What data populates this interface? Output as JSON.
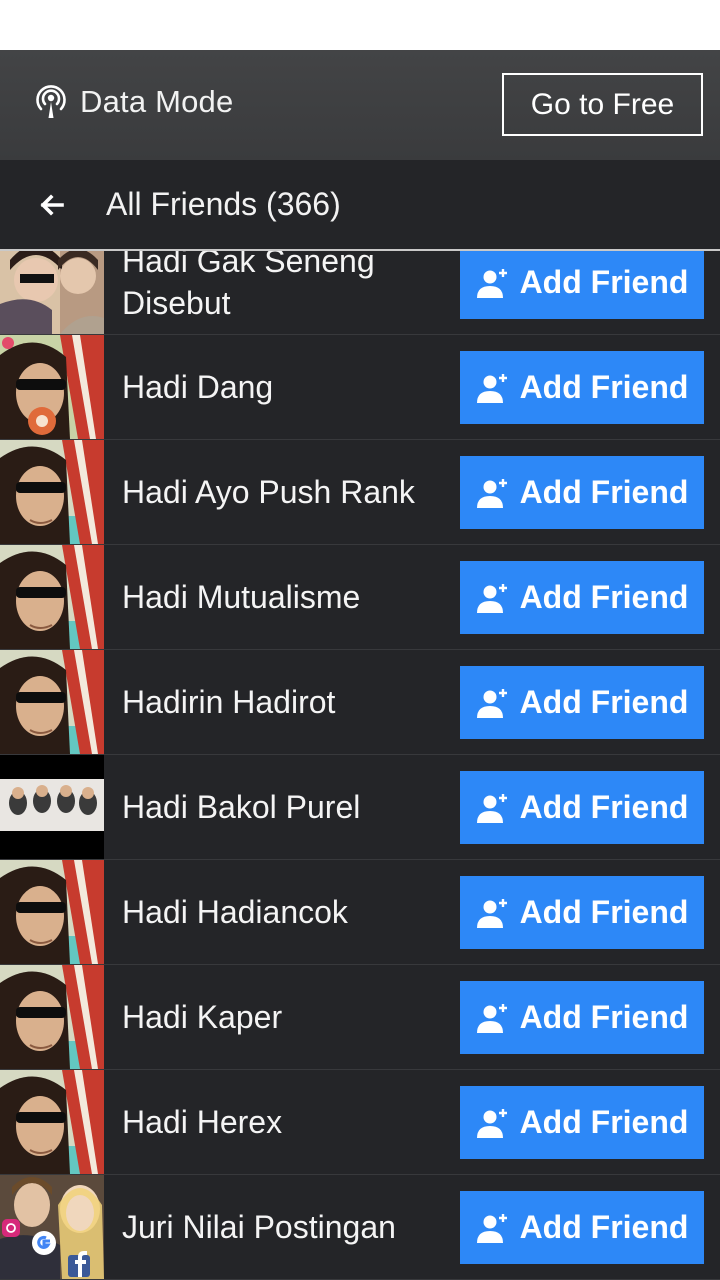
{
  "data_bar": {
    "mode_icon": "broadcast-signal-icon",
    "mode_label": "Data Mode",
    "free_button": "Go to Free"
  },
  "header": {
    "back_icon": "back-arrow-icon",
    "title": "All Friends (366)"
  },
  "friends": [
    {
      "name": "Hadi Gak Seneng Disebut",
      "button": "Add Friend"
    },
    {
      "name": "Hadi Dang",
      "button": "Add Friend"
    },
    {
      "name": "Hadi Ayo Push Rank",
      "button": "Add Friend"
    },
    {
      "name": "Hadi Mutualisme",
      "button": "Add Friend"
    },
    {
      "name": "Hadirin Hadirot",
      "button": "Add Friend"
    },
    {
      "name": "Hadi Bakol Purel",
      "button": "Add Friend"
    },
    {
      "name": "Hadi Hadiancok",
      "button": "Add Friend"
    },
    {
      "name": "Hadi Kaper",
      "button": "Add Friend"
    },
    {
      "name": "Hadi Herex",
      "button": "Add Friend"
    },
    {
      "name": "Juri Nilai Postingan",
      "button": "Add Friend"
    }
  ],
  "colors": {
    "accent": "#2d88f7",
    "background": "#242528",
    "data_bar": "#3e3f41"
  }
}
